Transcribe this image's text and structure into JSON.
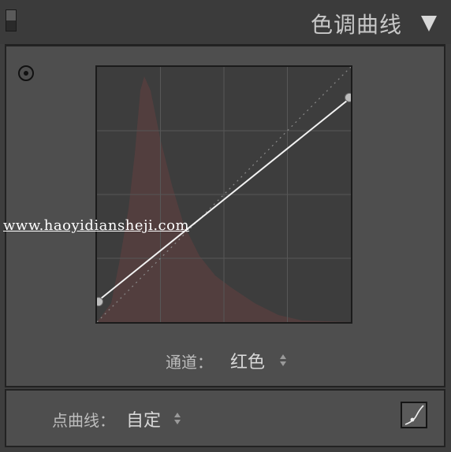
{
  "header": {
    "title": "色调曲线"
  },
  "channel": {
    "label": "通道：",
    "value": "红色"
  },
  "point_curve": {
    "label": "点曲线：",
    "value": "自定"
  },
  "watermark": {
    "text": "www.haoyidiansheji.com"
  },
  "curve": {
    "points": [
      [
        0,
        0.08
      ],
      [
        1,
        0.88
      ]
    ],
    "line_color": "#f2f2f2",
    "point_color": "#bdbdbd",
    "histogram_color": "#5a3f3f"
  },
  "colors": {
    "panel_bg": "#3e3e3e",
    "content_bg": "#4e4e4e",
    "graph_bg": "#3d3d3d"
  }
}
